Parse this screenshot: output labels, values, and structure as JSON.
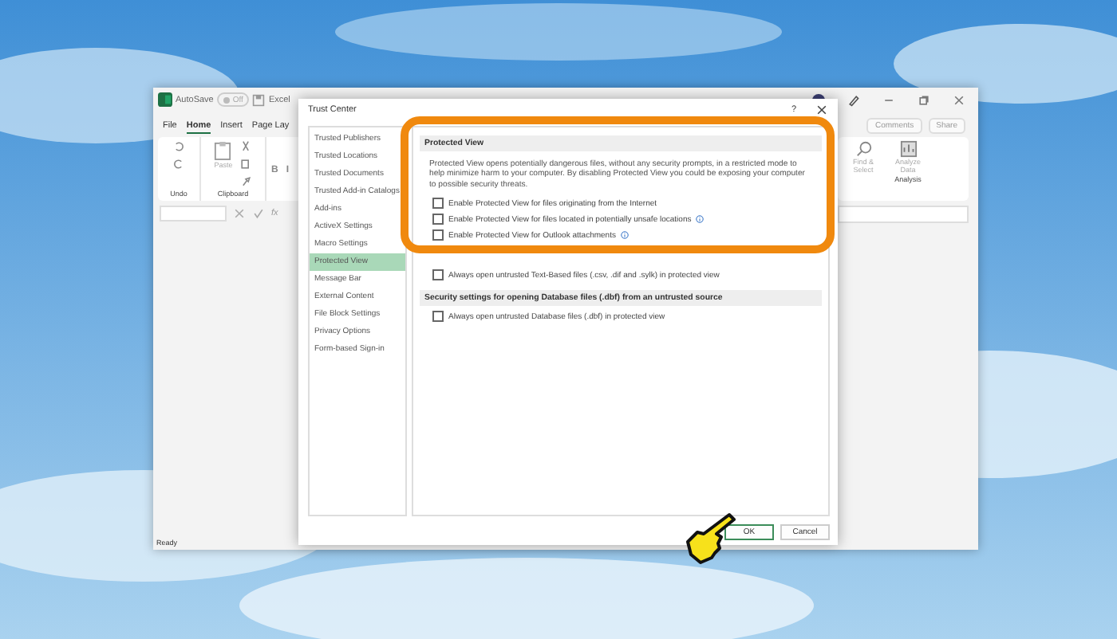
{
  "excel": {
    "autosave_label": "AutoSave",
    "autosave_toggle": {
      "label": "Off",
      "on": false
    },
    "title": "Excel",
    "menu_tabs": [
      {
        "label": "File",
        "selected": false
      },
      {
        "label": "Home",
        "selected": true
      },
      {
        "label": "Insert",
        "selected": false
      },
      {
        "label": "Page Lay",
        "selected": false
      }
    ],
    "undo_group": "Undo",
    "clipboard_group": "Clipboard",
    "paste": "Paste",
    "font_buttons": [
      "B",
      "I"
    ],
    "comments": "Comments",
    "share": "Share",
    "find_select": "Find & Select",
    "analyze_data": "Analyze Data",
    "analysis_group": "Analysis",
    "formula_label": "fx",
    "status": "Ready"
  },
  "dialog": {
    "title": "Trust Center",
    "help": "?",
    "sidebar": [
      {
        "label": "Trusted Publishers",
        "selected": false
      },
      {
        "label": "Trusted Locations",
        "selected": false
      },
      {
        "label": "Trusted Documents",
        "selected": false
      },
      {
        "label": "Trusted Add-in Catalogs",
        "selected": false
      },
      {
        "label": "Add-ins",
        "selected": false
      },
      {
        "label": "ActiveX Settings",
        "selected": false
      },
      {
        "label": "Macro Settings",
        "selected": false
      },
      {
        "label": "Protected View",
        "selected": true
      },
      {
        "label": "Message Bar",
        "selected": false
      },
      {
        "label": "External Content",
        "selected": false
      },
      {
        "label": "File Block Settings",
        "selected": false
      },
      {
        "label": "Privacy Options",
        "selected": false
      },
      {
        "label": "Form-based Sign-in",
        "selected": false
      }
    ],
    "sections": [
      {
        "heading": "Protected View",
        "description": "Protected View opens potentially dangerous files, without any security prompts, in a restricted mode to help minimize harm to your computer. By disabling Protected View you could be exposing your computer to possible security threats.",
        "options": [
          {
            "label": "Enable Protected View for files originating from the Internet",
            "checked": false
          },
          {
            "label": "Enable Protected View for files located in potentially unsafe locations",
            "checked": false,
            "info": true
          },
          {
            "label": "Enable Protected View for Outlook attachments",
            "checked": false,
            "info": true
          }
        ]
      },
      {
        "options": [
          {
            "label": "Always open untrusted Text-Based files (.csv, .dif and .sylk) in protected view",
            "checked": false
          }
        ]
      },
      {
        "heading": "Security settings for opening Database files (.dbf) from an untrusted source",
        "options": [
          {
            "label": "Always open untrusted Database files (.dbf) in protected view",
            "checked": false
          }
        ]
      }
    ],
    "buttons": [
      {
        "label": "OK",
        "default": true
      },
      {
        "label": "Cancel",
        "default": false
      }
    ]
  }
}
